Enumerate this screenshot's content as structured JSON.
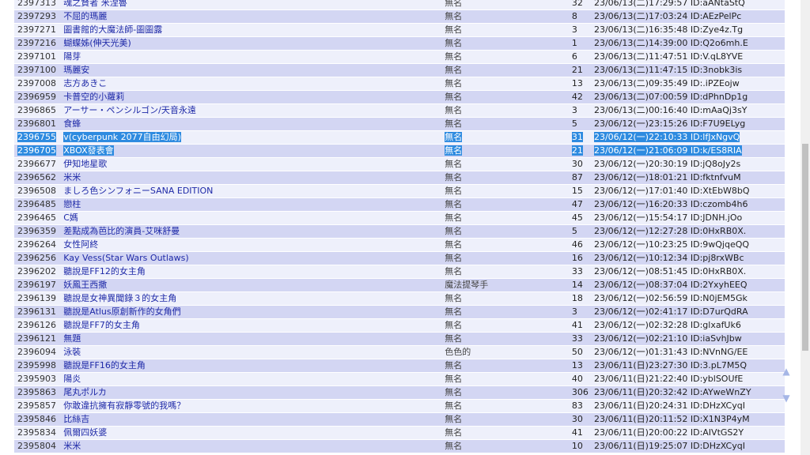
{
  "rows": [
    {
      "no": "2397313",
      "title": "魂之賢者 米涅魯",
      "name": "無名",
      "count": "32",
      "date": "23/06/13(二)17:29:57 ID:aANtaStQ"
    },
    {
      "no": "2397293",
      "title": "不屈的瑪麗",
      "name": "無名",
      "count": "8",
      "date": "23/06/13(二)17:03:24 ID:AEzPelPc"
    },
    {
      "no": "2397271",
      "title": "圖書館的大魔法師-圖圖露",
      "name": "無名",
      "count": "3",
      "date": "23/06/13(二)16:35:48 ID:Zye4z.Tg"
    },
    {
      "no": "2397216",
      "title": "蝴蝶姊(伸天光美)",
      "name": "無名",
      "count": "1",
      "date": "23/06/13(二)14:39:00 ID:Q2o6mh.E"
    },
    {
      "no": "2397101",
      "title": "陽芽",
      "name": "無名",
      "count": "6",
      "date": "23/06/13(二)11:47:51 ID:V.qL8YVE"
    },
    {
      "no": "2397100",
      "title": "瑪麗安",
      "name": "無名",
      "count": "21",
      "date": "23/06/13(二)11:47:15 ID:3nobk3is"
    },
    {
      "no": "2397008",
      "title": "志方あきこ",
      "name": "無名",
      "count": "13",
      "date": "23/06/13(二)09:35:49 ID:.iPZEojw"
    },
    {
      "no": "2396959",
      "title": "卡普空的小蘿莉",
      "name": "無名",
      "count": "42",
      "date": "23/06/13(二)07:00:59 ID:dPhnDp1g"
    },
    {
      "no": "2396865",
      "title": "アーサー・ペンシルゴン/天音永遠",
      "name": "無名",
      "count": "3",
      "date": "23/06/13(二)00:16:40 ID:mAaQj3sY"
    },
    {
      "no": "2396801",
      "title": "食蜂",
      "name": "無名",
      "count": "5",
      "date": "23/06/12(一)23:15:26 ID:F7U9ELyg"
    },
    {
      "no": "2396755",
      "title": "v(cyberpunk 2077自由幻局)",
      "name": "無名",
      "count": "31",
      "date": "23/06/12(一)22:10:33 ID:lfJxNgvQ",
      "selected": true
    },
    {
      "no": "2396705",
      "title": "XBOX發表會",
      "name": "無名",
      "count": "21",
      "date": "23/06/12(一)21:06:09 ID:k/ES8RIA",
      "selected": true
    },
    {
      "no": "2396677",
      "title": "伊知地星歌",
      "name": "無名",
      "count": "30",
      "date": "23/06/12(一)20:30:19 ID:jQ8oJy2s"
    },
    {
      "no": "2396562",
      "title": "米米",
      "name": "無名",
      "count": "87",
      "date": "23/06/12(一)18:01:21 ID:fktnfvuM"
    },
    {
      "no": "2396508",
      "title": "ましろ色シンフォニーSANA EDITION",
      "name": "無名",
      "count": "15",
      "date": "23/06/12(一)17:01:40 ID:XtEbW8bQ"
    },
    {
      "no": "2396485",
      "title": "戀柱",
      "name": "無名",
      "count": "47",
      "date": "23/06/12(一)16:20:33 ID:czomb4h6"
    },
    {
      "no": "2396465",
      "title": "C媽",
      "name": "無名",
      "count": "45",
      "date": "23/06/12(一)15:54:17 ID:JDNH.jOo"
    },
    {
      "no": "2396359",
      "title": "差點成為芭比的演員-艾咪舒曼",
      "name": "無名",
      "count": "5",
      "date": "23/06/12(一)12:27:28 ID:0HxRB0X."
    },
    {
      "no": "2396264",
      "title": "女性阿終",
      "name": "無名",
      "count": "46",
      "date": "23/06/12(一)10:23:25 ID:9wQjqeQQ"
    },
    {
      "no": "2396256",
      "title": "Kay Vess(Star Wars Outlaws)",
      "name": "無名",
      "count": "16",
      "date": "23/06/12(一)10:12:34 ID:pj8rxWBc"
    },
    {
      "no": "2396202",
      "title": "聽說是FF12的女主角",
      "name": "無名",
      "count": "33",
      "date": "23/06/12(一)08:51:45 ID:0HxRB0X."
    },
    {
      "no": "2396197",
      "title": "妖鳳王西撒",
      "name": "魔法提琴手",
      "count": "14",
      "date": "23/06/12(一)08:37:04 ID:2YxyhEEQ"
    },
    {
      "no": "2396139",
      "title": "聽說是女神異聞錄３的女主角",
      "name": "無名",
      "count": "18",
      "date": "23/06/12(一)02:56:59 ID:N0jEM5Gk"
    },
    {
      "no": "2396131",
      "title": "聽說是Atlus原創新作的女角們",
      "name": "無名",
      "count": "3",
      "date": "23/06/12(一)02:41:17 ID:D7urQdRA"
    },
    {
      "no": "2396126",
      "title": "聽說是FF7的女主角",
      "name": "無名",
      "count": "41",
      "date": "23/06/12(一)02:32:28 ID:glxafUk6"
    },
    {
      "no": "2396121",
      "title": "無題",
      "name": "無名",
      "count": "33",
      "date": "23/06/12(一)02:21:10 ID:iaSvhJbw"
    },
    {
      "no": "2396094",
      "title": "泳裝",
      "name": "色色的",
      "count": "50",
      "date": "23/06/12(一)01:31:43 ID:NVnNG/EE"
    },
    {
      "no": "2395998",
      "title": "聽說是FF16的女主角",
      "name": "無名",
      "count": "13",
      "date": "23/06/11(日)23:27:30 ID:3.pL7M5Q"
    },
    {
      "no": "2395903",
      "title": "陽炎",
      "name": "無名",
      "count": "40",
      "date": "23/06/11(日)21:22:40 ID:yblSOUfE"
    },
    {
      "no": "2395863",
      "title": "尾丸ポルカ",
      "name": "無名",
      "count": "306",
      "date": "23/06/11(日)20:32:42 ID:AYweWnZY"
    },
    {
      "no": "2395857",
      "title": "你敢違抗擁有寂靜零號的我嗎？",
      "name": "無名",
      "count": "83",
      "date": "23/06/11(日)20:24:31 ID:DHzXCyqI"
    },
    {
      "no": "2395846",
      "title": "比絲吉",
      "name": "無名",
      "count": "30",
      "date": "23/06/11(日)20:11:52 ID:X1N3P4yM"
    },
    {
      "no": "2395834",
      "title": "佩爾四妖婆",
      "name": "無名",
      "count": "41",
      "date": "23/06/11(日)20:00:22 ID:AIVtGS2Y"
    },
    {
      "no": "2395804",
      "title": "米米",
      "name": "無名",
      "count": "10",
      "date": "23/06/11(日)19:25:07 ID:DHzXCyqI"
    }
  ],
  "nav": {
    "up": "▲",
    "down": "▼"
  }
}
